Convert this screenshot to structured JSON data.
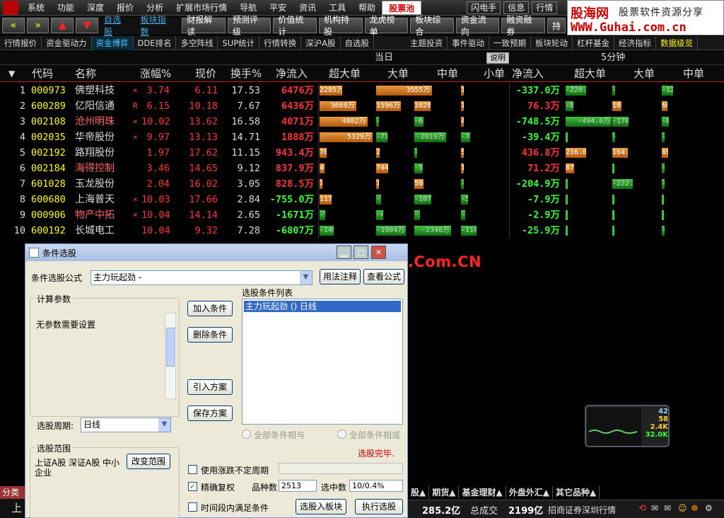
{
  "menu": [
    "系统",
    "功能",
    "深度",
    "报价",
    "分析",
    "扩展市场行情",
    "导航",
    "平安",
    "资讯",
    "工具",
    "帮助"
  ],
  "menu_hot": "股票池",
  "menu_right": [
    "闪电手",
    "信息",
    "行情"
  ],
  "brand": {
    "name": "股海网",
    "tagline": "股票软件资源分享",
    "url": "WWW.Guhai.com.cn"
  },
  "toolbar": {
    "links": [
      "自选股",
      "板块指数"
    ],
    "buttons": [
      "财报解读",
      "预测评级",
      "价值统计",
      "机构持股",
      "龙虎榜单",
      "板块综合",
      "资金流向",
      "融资融券",
      "持"
    ]
  },
  "tabs": [
    "行情报价",
    "资金驱动力",
    "资金博弈",
    "DDE排名",
    "多空阵线",
    "SUP统计",
    "行情转换",
    "深沪A股",
    "自选股",
    "主题投资",
    "事件驱动",
    "一致预期",
    "板块轮动",
    "杠杆基金",
    "经济指标",
    "数据级览"
  ],
  "active_tab": "资金博弈",
  "header": {
    "group_today": "当日",
    "group_5min": "5分钟",
    "explain": "说明",
    "cols": [
      "代码",
      "名称",
      "涨幅%",
      "现价",
      "换手%",
      "净流入",
      "超大单",
      "大单",
      "中单",
      "小单",
      "净流入",
      "超大单",
      "大单",
      "中单"
    ]
  },
  "rows": [
    {
      "idx": "1",
      "code": "000973",
      "name": "佛塑科技",
      "mark": "×",
      "chg": "3.74",
      "px": "6.11",
      "to": "17.53",
      "net": "6476万",
      "b": [
        "2285万",
        "3536万",
        "554.1万",
        "100.3万"
      ],
      "net5": "-337.0万",
      "b5": [
        "-220.3万",
        "-14.8万",
        "-123.3万"
      ]
    },
    {
      "idx": "2",
      "code": "600289",
      "name": "亿阳信通",
      "mark": "R",
      "chg": "6.15",
      "px": "10.18",
      "to": "7.67",
      "net": "6436万",
      "b": [
        "3669万",
        "1596万",
        "1028万",
        "142.9万"
      ],
      "net5": "76.3万",
      "b5": [
        "-81.4万",
        "101.7万",
        "60.9万"
      ]
    },
    {
      "idx": "3",
      "code": "002108",
      "name": "沧州明珠",
      "mark": "×",
      "chg": "10.02",
      "px": "13.62",
      "to": "16.58",
      "net": "4071万",
      "b": [
        "4802万",
        "-176.5万",
        "-602.6万",
        "48.1万"
      ],
      "net5": "-748.5万",
      "b5": [
        "-494.6万",
        "-170.7万",
        "-81.3万"
      ]
    },
    {
      "idx": "4",
      "code": "002035",
      "name": "华帝股份",
      "mark": "×",
      "chg": "9.97",
      "px": "13.13",
      "to": "14.71",
      "net": "1888万",
      "b": [
        "5329万",
        "-712.1万",
        "-2019万",
        "-709.4万"
      ],
      "net5": "-39.4万",
      "b5": [
        "",
        "-26.0万",
        "-9.0万"
      ]
    },
    {
      "idx": "5",
      "code": "002192",
      "name": "路翔股份",
      "mark": "",
      "chg": "1.97",
      "px": "17.62",
      "to": "11.15",
      "net": "943.4万",
      "b": [
        "700.1万",
        "236.7万",
        "-43.6万",
        "50.3万"
      ],
      "net5": "436.8万",
      "b5": [
        "216.0万",
        "164.6万",
        "69.5万"
      ]
    },
    {
      "idx": "6",
      "code": "002184",
      "name": "海得控制",
      "mark": "",
      "chg": "3.46",
      "px": "14.65",
      "to": "9.12",
      "net": "837.9万",
      "b": [
        "467.8万",
        "744.7万",
        "-517.9万",
        "143.5万"
      ],
      "net5": "71.2万",
      "b5": [
        "87.3万",
        "",
        "-14.7万"
      ]
    },
    {
      "idx": "7",
      "code": "601028",
      "name": "玉龙股份",
      "mark": "",
      "chg": "2.04",
      "px": "16.02",
      "to": "3.05",
      "net": "828.5万",
      "b": [
        "172.9万",
        "131.2万",
        "586.7万",
        "-62.3万"
      ],
      "net5": "-204.9万",
      "b5": [
        "",
        "-222.0万",
        "-3.0万"
      ]
    },
    {
      "idx": "8",
      "code": "600680",
      "name": "上海普天",
      "mark": "×",
      "chg": "10.03",
      "px": "17.66",
      "to": "2.84",
      "net": "-755.0万",
      "b": [
        "1173万",
        "-305.1万",
        "-1076万",
        "-547.2万"
      ],
      "net5": "-7.9万",
      "b5": [
        "",
        "",
        ""
      ]
    },
    {
      "idx": "9",
      "code": "000906",
      "name": "物产中拓",
      "mark": "×",
      "chg": "10.04",
      "px": "14.14",
      "to": "2.65",
      "net": "-1671万",
      "b": [
        "-558.5万",
        "-443.9万",
        "-346.6万",
        "-323.1万"
      ],
      "net5": "-2.9万",
      "b5": [
        "",
        "",
        ""
      ]
    },
    {
      "idx": "10",
      "code": "600192",
      "name": "长城电工",
      "mark": "",
      "chg": "10.04",
      "px": "9.32",
      "to": "7.28",
      "net": "-6807万",
      "b": [
        "-1408万",
        "-1904万",
        "-2346万",
        "-1149万"
      ],
      "net5": "-25.9万",
      "b5": [
        "",
        "",
        "-8.8万"
      ]
    }
  ],
  "watermark": "股海网提供 Www.Guhai.Com.CN",
  "dialog": {
    "title": "条件选股",
    "formula_label": "条件选股公式",
    "formula_value": "主力玩起劲 -",
    "btn_usage": "用法注释",
    "btn_view": "查看公式",
    "calc_params": "计算参数",
    "no_params": "无参数需要设置",
    "add": "加入条件",
    "del": "删除条件",
    "import": "引入方案",
    "save": "保存方案",
    "cond_list_label": "选股条件列表",
    "cond_item": "主力玩起劲 () 日线",
    "period_label": "选股周期:",
    "period_value": "日线",
    "radio_and": "全部条件相与",
    "radio_or": "全部条件相或",
    "done": "选股完毕.",
    "scope_label": "选股范围",
    "scope_value": "上证A股 深证A股 中小企业",
    "change_scope": "改变范围",
    "use_chg": "使用涨跌不定周期",
    "fq": "精确复权",
    "count_label": "品种数",
    "count": "2513",
    "sel_label": "选中数",
    "sel": "10/0.4%",
    "time_cond": "时间段内满足条件",
    "to_block": "选股入板块",
    "run": "执行选股"
  },
  "bottom_tabs": [
    "股▲",
    "期货▲",
    "基金理财▲",
    "外盘外汇▲",
    "其它品种▲"
  ],
  "status": {
    "amt": "285.2亿",
    "vol_label": "总成交",
    "vol": "2199亿",
    "broker": "招商证券深圳行情"
  },
  "widget": {
    "v1": "42",
    "v2": "58",
    "v3": "2.4K",
    "v4": "32.0K"
  },
  "left_bottom": {
    "tab": "分类",
    "cell": "上"
  }
}
